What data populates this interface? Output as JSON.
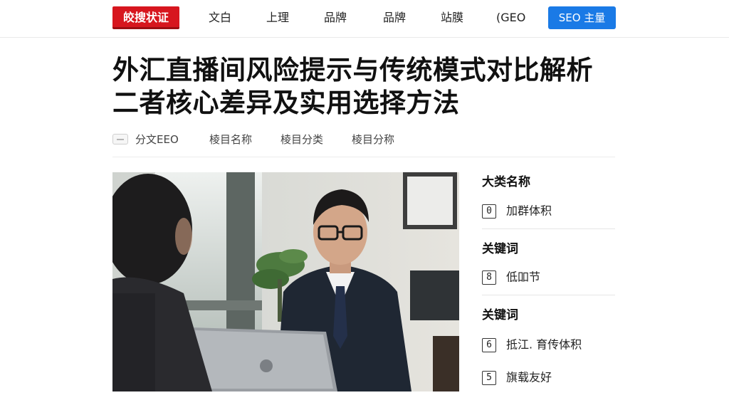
{
  "nav": {
    "logo": "皎搜状证",
    "items": [
      "文白",
      "上理",
      "品牌",
      "品牌",
      "站膜",
      "(GEO"
    ],
    "seo_button": "SEO 主量"
  },
  "article": {
    "title_lines": [
      "外汇直播间风险提示与传统模式对比解析",
      "二者核心差异及实用选择方法"
    ],
    "meta": [
      "分文EEO",
      "棱目名称",
      "棱目分类",
      "棱目分称"
    ]
  },
  "sidebar": {
    "sections": [
      {
        "heading": "大类名称",
        "items": [
          {
            "num": "0",
            "label": "加群体积"
          }
        ]
      },
      {
        "heading": "关键词",
        "items": [
          {
            "num": "8",
            "label": "低吅节"
          }
        ]
      },
      {
        "heading": "关键词",
        "items": [
          {
            "num": "6",
            "label": "抵江. 育传体积"
          },
          {
            "num": "5",
            "label": "旗载友好"
          }
        ]
      }
    ]
  },
  "colors": {
    "brand_red": "#d7161e",
    "accent_blue": "#1a7ae6"
  }
}
